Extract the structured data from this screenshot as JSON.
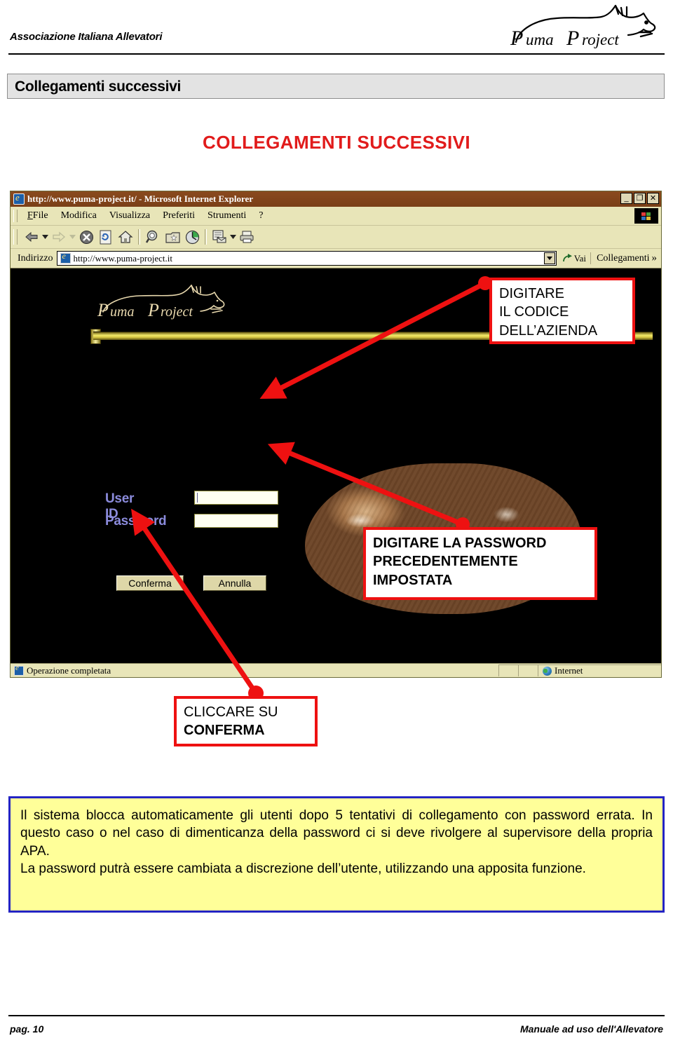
{
  "header": {
    "organization": "Associazione Italiana Allevatori",
    "logo_text": "Puma Project",
    "logo_icon": "puma-silhouette-logo"
  },
  "section": {
    "title": "Collegamenti successivi"
  },
  "document": {
    "title": "COLLEGAMENTI SUCCESSIVI",
    "title_color": "#e11b1b"
  },
  "browser": {
    "window_title": "http://www.puma-project.it/ - Microsoft Internet Explorer",
    "window_controls": {
      "minimize": "_",
      "restore": "❐",
      "close": "✕"
    },
    "menu": [
      {
        "label": "File",
        "accel": "F"
      },
      {
        "label": "Modifica",
        "accel": "M"
      },
      {
        "label": "Visualizza",
        "accel": "V"
      },
      {
        "label": "Preferiti",
        "accel": "P"
      },
      {
        "label": "Strumenti",
        "accel": "S"
      },
      {
        "label": "?",
        "accel": ""
      }
    ],
    "toolbar_icons": [
      "back-arrow-icon",
      "back-dropdown-icon",
      "forward-arrow-icon",
      "forward-dropdown-icon",
      "stop-icon",
      "refresh-icon",
      "home-icon",
      "search-icon",
      "favorites-icon",
      "history-icon",
      "mail-icon",
      "mail-dropdown-icon",
      "print-icon"
    ],
    "address": {
      "label": "Indirizzo",
      "value": "http://www.puma-project.it",
      "placeholder": "http://",
      "icon": "ie-page-icon",
      "dropdown_icon": "chevron-down-icon"
    },
    "go_button": {
      "label": "Vai",
      "icon": "go-arrow-icon"
    },
    "links_button": {
      "label": "Collegamenti",
      "icon": "chevrons-right-icon"
    },
    "statusbar": {
      "message": "Operazione completata",
      "zone": "Internet",
      "zone_icon": "internet-globe-icon",
      "page_icon": "ie-page-icon"
    },
    "page": {
      "logo_text": "Puma Project",
      "fields": [
        {
          "name": "User ID",
          "label": "User ID",
          "value": ""
        },
        {
          "name": "Password",
          "label": "Password",
          "value": ""
        }
      ],
      "buttons": [
        {
          "name": "conferma",
          "label": "Conferma"
        },
        {
          "name": "annulla",
          "label": "Annulla"
        }
      ],
      "image_alt": "two-pumas-photo",
      "label_color": "#8b8bdc",
      "background_color": "#000000"
    }
  },
  "annotations": [
    {
      "id": "codice",
      "lines": [
        "DIGITARE",
        "IL CODICE",
        "DELL’AZIENDA"
      ],
      "target": "user-id-field",
      "color": "#ee1111"
    },
    {
      "id": "password",
      "lines": [
        "DIGITARE LA PASSWORD",
        "PRECEDENTEMENTE",
        "IMPOSTATA"
      ],
      "target": "password-field",
      "color": "#ee1111"
    },
    {
      "id": "conferma",
      "lines": [
        "CLICCARE SU",
        "CONFERMA"
      ],
      "bold_line_index": 1,
      "target": "conferma-button",
      "color": "#ee1111"
    }
  ],
  "note": {
    "border_color": "#2424c4",
    "background_color": "#ffff99",
    "paragraphs": [
      "Il sistema blocca automaticamente gli utenti dopo 5 tentativi di collegamento con password errata. In questo caso o nel caso di dimenticanza della password ci si deve rivolgere al supervisore della propria APA.",
      "La password putrà essere cambiata a discrezione dell’utente, utilizzando una apposita funzione."
    ]
  },
  "footer": {
    "page_label": "pag. 10",
    "manual_label": "Manuale ad uso dell'Allevatore"
  }
}
